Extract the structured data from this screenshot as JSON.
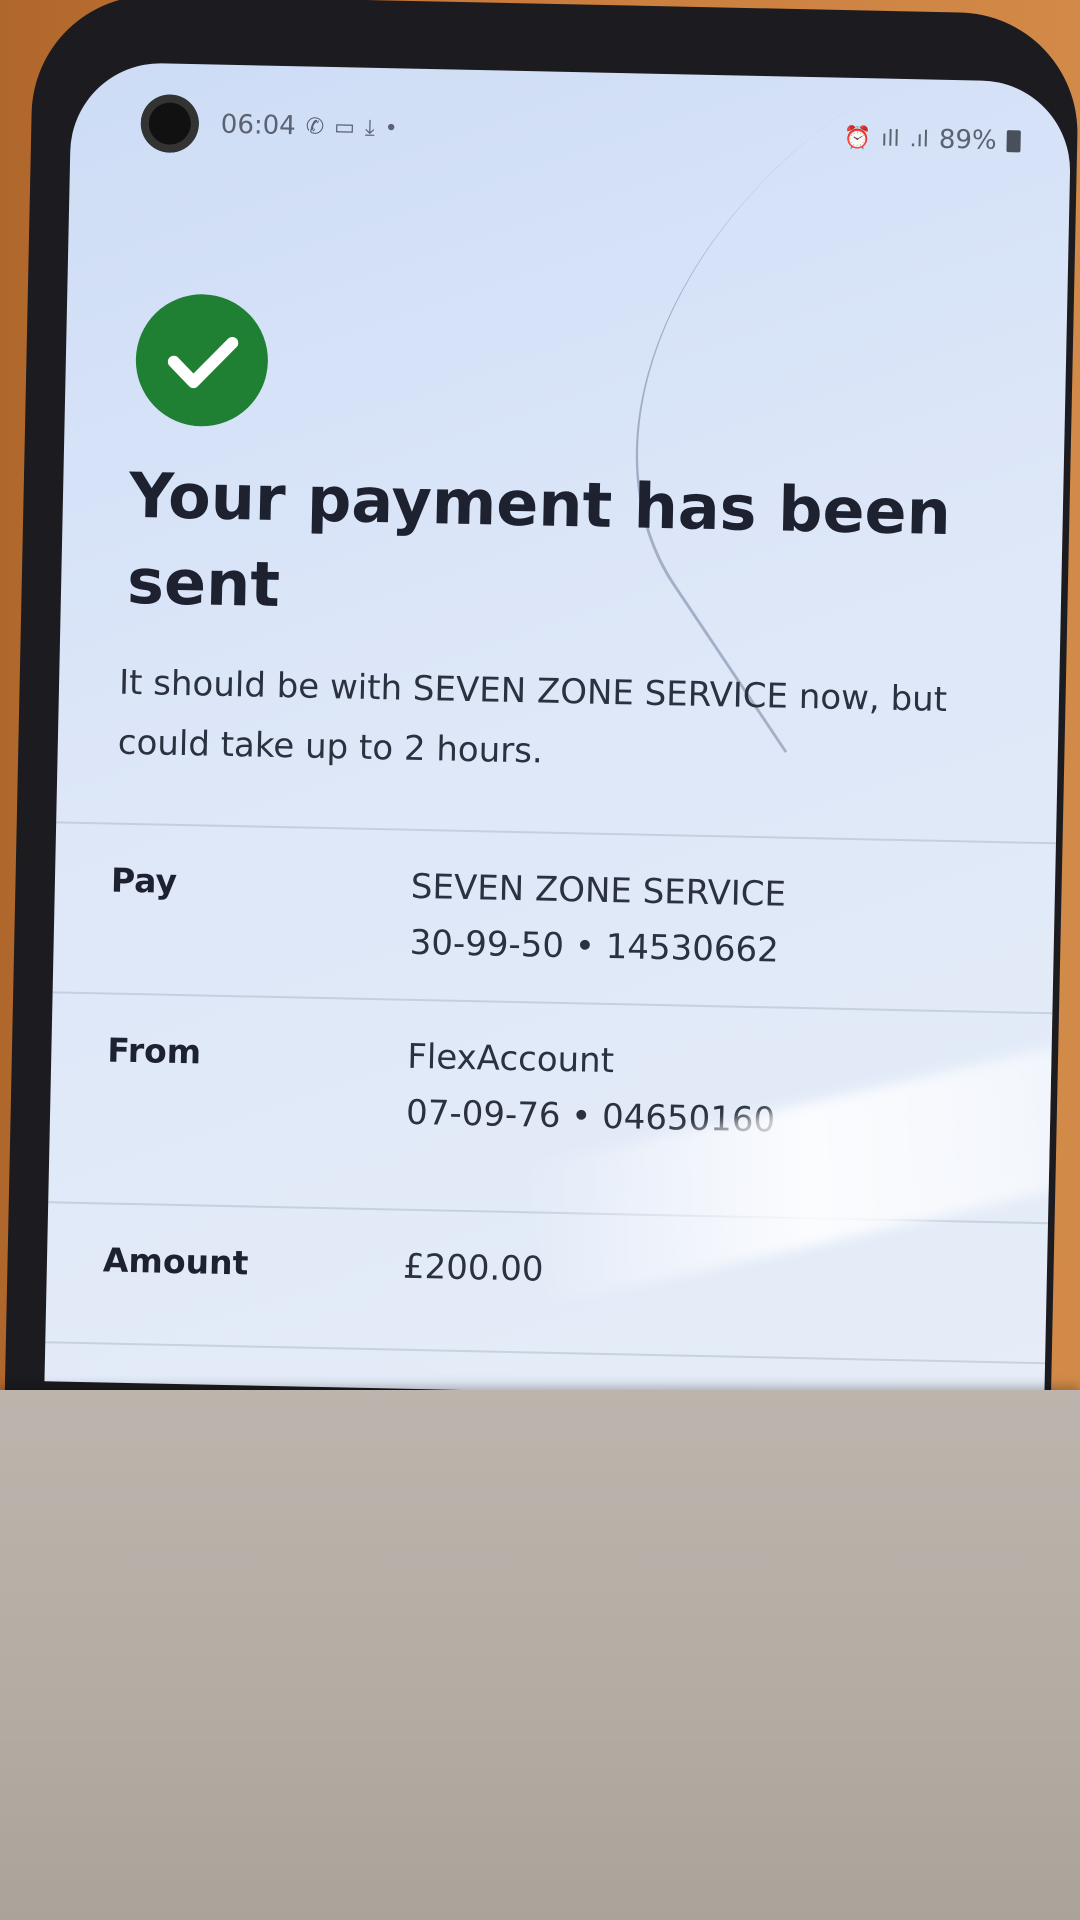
{
  "status_bar": {
    "time": "06:04",
    "battery_percent": "89%",
    "left_icons": [
      "whatsapp-icon",
      "message-icon",
      "download-icon",
      "dot-icon"
    ],
    "right_icons": [
      "alarm-icon",
      "wifi-icon",
      "signal-icon",
      "battery-icon"
    ]
  },
  "confirmation": {
    "icon": "check-icon",
    "icon_color": "#1f7f33",
    "title": "Your payment has been sent",
    "message": "It should be with SEVEN ZONE SERVICE now, but could take up to 2 hours."
  },
  "details": {
    "pay": {
      "label": "Pay",
      "name": "SEVEN ZONE SERVICE",
      "account": "30-99-50 • 14530662"
    },
    "from": {
      "label": "From",
      "name": "FlexAccount",
      "account": "07-09-76 • 04650160"
    },
    "amount": {
      "label": "Amount",
      "value": "£200.00"
    }
  }
}
